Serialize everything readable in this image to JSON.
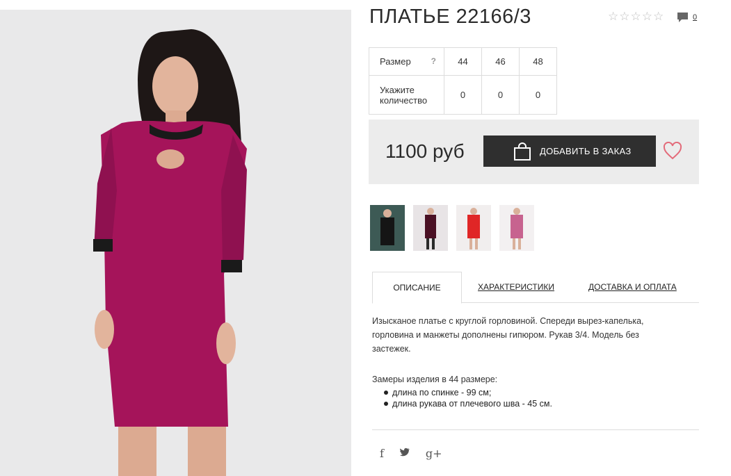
{
  "product": {
    "title": "ПЛАТЬЕ 22166/3",
    "rating_stars": [
      "☆",
      "☆",
      "☆",
      "☆",
      "☆"
    ],
    "comments_count": "0"
  },
  "size_table": {
    "size_label": "Размер",
    "help_mark": "?",
    "sizes": [
      "44",
      "46",
      "48"
    ],
    "qty_label": "Укажите количество",
    "quantities": [
      "0",
      "0",
      "0"
    ]
  },
  "buy": {
    "price": "1100 руб",
    "add_button_label": "ДОБАВИТЬ В ЗАКАЗ"
  },
  "tabs": [
    {
      "label": "ОПИСАНИЕ"
    },
    {
      "label": "ХАРАКТЕРИСТИКИ"
    },
    {
      "label": "ДОСТАВКА И ОПЛАТА"
    }
  ],
  "description": {
    "text": "Изысканое платье с круглой горловиной. Спереди вырез-капелька, горловина и манжеты дополнены гипюром. Рукав 3/4. Модель без застежек.",
    "measures_title": "Замеры изделия в 44 размере:",
    "measures": [
      "длина по спинке - 99 см;",
      "длина рукава от плечевого шва - 45 см."
    ]
  },
  "social": {
    "facebook": "f",
    "twitter": "🐦",
    "gplus": "g+"
  },
  "icons": {
    "bag": "shopping-bag-icon",
    "heart": "heart-icon",
    "comment": "comment-icon"
  },
  "colors": {
    "button_bg": "#2f2f2f",
    "heart": "#e36b7a",
    "dress": "#a5145a"
  }
}
